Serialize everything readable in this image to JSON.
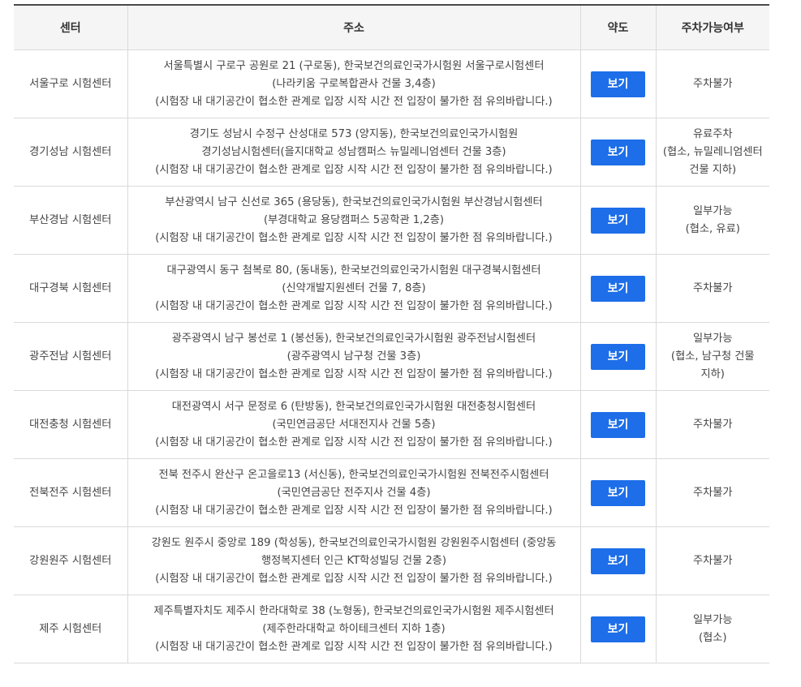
{
  "headers": {
    "center": "센터",
    "address": "주소",
    "map": "약도",
    "parking": "주차가능여부"
  },
  "rows": [
    {
      "center": "서울구로 시험센터",
      "address": [
        "서울특별시 구로구 공원로 21 (구로동), 한국보건의료인국가시험원 서울구로시험센터",
        "(나라키움 구로복합관사 건물 3,4층)",
        "(시험장 내 대기공간이 협소한 관계로 입장 시작 시간 전 입장이 불가한 점 유의바랍니다.)"
      ],
      "map_label": "보기",
      "parking": [
        "주차불가"
      ]
    },
    {
      "center": "경기성남 시험센터",
      "address": [
        "경기도 성남시 수정구 산성대로 573 (양지동), 한국보건의료인국가시험원",
        "경기성남시험센터(을지대학교 성남캠퍼스 뉴밀레니엄센터 건물 3층)",
        "(시험장 내 대기공간이 협소한 관계로 입장 시작 시간 전 입장이 불가한 점 유의바랍니다.)"
      ],
      "map_label": "보기",
      "parking": [
        "유료주차",
        "(협소, 뉴밀레니엄센터",
        "건물 지하)"
      ]
    },
    {
      "center": "부산경남 시험센터",
      "address": [
        "부산광역시 남구 신선로 365 (용당동), 한국보건의료인국가시험원 부산경남시험센터",
        "(부경대학교 용당캠퍼스 5공학관 1,2층)",
        "(시험장 내 대기공간이 협소한 관계로 입장 시작 시간 전 입장이 불가한 점 유의바랍니다.)"
      ],
      "map_label": "보기",
      "parking": [
        "일부가능",
        "(협소, 유료)"
      ]
    },
    {
      "center": "대구경북 시험센터",
      "address": [
        "대구광역시 동구 첨복로 80, (동내동), 한국보건의료인국가시험원 대구경북시험센터",
        "(신약개발지원센터 건물 7, 8층)",
        "(시험장 내 대기공간이 협소한 관계로 입장 시작 시간 전 입장이 불가한 점 유의바랍니다.)"
      ],
      "map_label": "보기",
      "parking": [
        "주차불가"
      ]
    },
    {
      "center": "광주전남 시험센터",
      "address": [
        "광주광역시 남구 봉선로 1 (봉선동), 한국보건의료인국가시험원 광주전남시험센터",
        "(광주광역시 남구청 건물 3층)",
        "(시험장 내 대기공간이 협소한 관계로 입장 시작 시간 전 입장이 불가한 점 유의바랍니다.)"
      ],
      "map_label": "보기",
      "parking": [
        "일부가능",
        "(협소, 남구청 건물",
        "지하)"
      ]
    },
    {
      "center": "대전충청 시험센터",
      "address": [
        "대전광역시 서구 문정로 6 (탄방동), 한국보건의료인국가시험원 대전충청시험센터",
        "(국민연금공단 서대전지사 건물 5층)",
        "(시험장 내 대기공간이 협소한 관계로 입장 시작 시간 전 입장이 불가한 점 유의바랍니다.)"
      ],
      "map_label": "보기",
      "parking": [
        "주차불가"
      ]
    },
    {
      "center": "전북전주 시험센터",
      "address": [
        "전북 전주시 완산구 온고을로13 (서신동), 한국보건의료인국가시험원 전북전주시험센터",
        "(국민연금공단 전주지사 건물 4층)",
        "(시험장 내 대기공간이 협소한 관계로 입장 시작 시간 전 입장이 불가한 점 유의바랍니다.)"
      ],
      "map_label": "보기",
      "parking": [
        "주차불가"
      ]
    },
    {
      "center": "강원원주 시험센터",
      "address": [
        "강원도 원주시 중앙로 189 (학성동), 한국보건의료인국가시험원 강원원주시험센터 (중앙동",
        "행정복지센터 인근 KT학성빌딩 건물 2층)",
        "(시험장 내 대기공간이 협소한 관계로 입장 시작 시간 전 입장이 불가한 점 유의바랍니다.)"
      ],
      "map_label": "보기",
      "parking": [
        "주차불가"
      ]
    },
    {
      "center": "제주 시험센터",
      "address": [
        "제주특별자치도 제주시 한라대학로 38 (노형동), 한국보건의료인국가시험원 제주시험센터",
        "(제주한라대학교 하이테크센터 지하 1층)",
        "(시험장 내 대기공간이 협소한 관계로 입장 시작 시간 전 입장이 불가한 점 유의바랍니다.)"
      ],
      "map_label": "보기",
      "parking": [
        "일부가능",
        "(협소)"
      ]
    }
  ]
}
